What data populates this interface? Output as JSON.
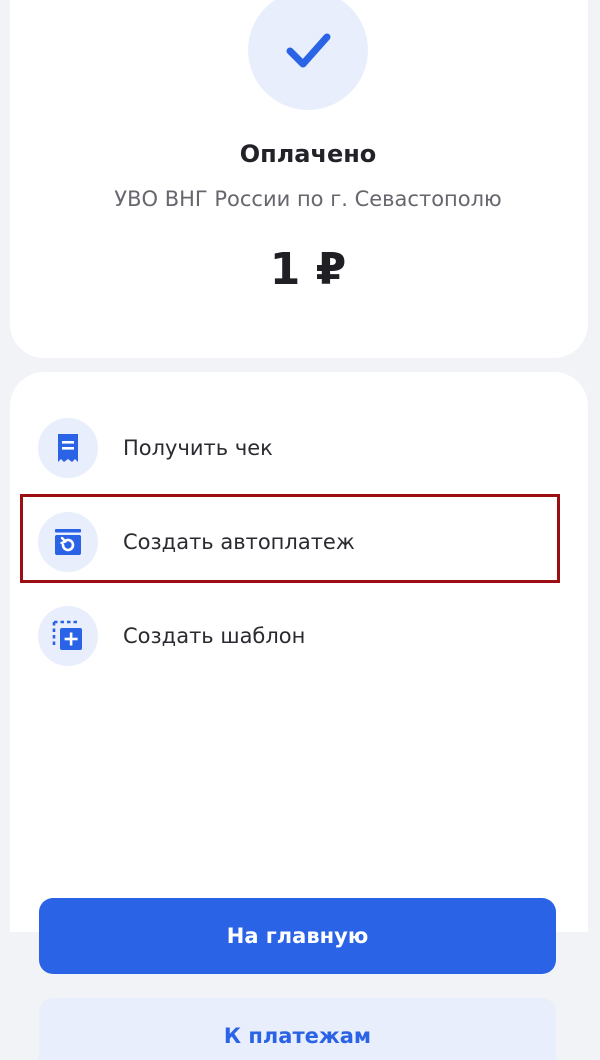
{
  "status": {
    "title": "Оплачено",
    "recipient": "УВО ВНГ России по г. Севастополю",
    "amount": "1 ₽",
    "icon": "checkmark-icon"
  },
  "actions": [
    {
      "label": "Получить чек",
      "icon": "receipt-icon"
    },
    {
      "label": "Создать автоплатеж",
      "icon": "autopay-icon"
    },
    {
      "label": "Создать шаблон",
      "icon": "template-add-icon"
    }
  ],
  "buttons": {
    "primary": "На главную",
    "secondary": "К платежам"
  },
  "colors": {
    "accent": "#2b63e6",
    "icon_bg": "#e8eefb",
    "highlight": "#9b0f12"
  }
}
